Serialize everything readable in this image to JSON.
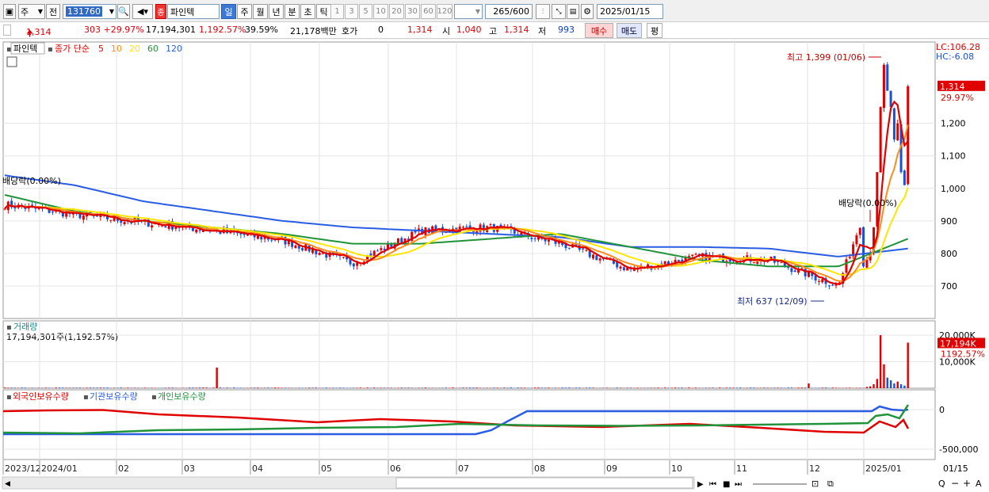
{
  "toolbar": {
    "period_toggle": "주",
    "prev_toggle": "전",
    "code": "131760",
    "name_badge": "종",
    "name": "파인텍",
    "timeframes": [
      "일",
      "주",
      "월",
      "년",
      "분",
      "초",
      "틱"
    ],
    "intervals": [
      "1",
      "3",
      "5",
      "10",
      "20",
      "30",
      "60",
      "120"
    ],
    "count": "265",
    "count_total": "/600",
    "date": "2025/01/15"
  },
  "quote": {
    "price": "1,314",
    "change": "303 +29.97%",
    "volume": "17,194,301",
    "volume_ratio": "1,192.57%",
    "turnover": "39.59%",
    "amount": "21,178백만",
    "hoga_label": "호가",
    "hoga_value": "0",
    "hoga_price": "1,314",
    "open_label": "시",
    "open": "1,040",
    "high_label": "고",
    "high": "1,314",
    "low_label": "저",
    "low": "993",
    "buy": "매수",
    "sell": "매도",
    "eval": "평"
  },
  "price_panel": {
    "name": "파인텍",
    "ma_label": "종가 단순",
    "ma_periods": [
      "5",
      "10",
      "20",
      "60",
      "120"
    ],
    "ma_colors": [
      "#e00000",
      "#ff8c1a",
      "#ffe600",
      "#21933a",
      "#2a5de3"
    ],
    "lc": "LC:106.28",
    "hc": "HC:-6.08",
    "last_price_tag": "1,314",
    "last_change_tag": "29.97%",
    "y_ticks": [
      "1,200",
      "1,100",
      "1,000",
      "900",
      "800",
      "700"
    ],
    "annotations": {
      "high": "최고 1,399 (01/06)",
      "low": "최저 637 (12/09)",
      "dividend_left": "배당락(0.00%)",
      "dividend_right": "배당락(0.00%)"
    }
  },
  "volume_panel": {
    "title": "거래량",
    "value_line": "17,194,301주(1,192.57%)",
    "y_ticks": [
      "20,000K",
      "10,000K"
    ],
    "tag": "17,194K",
    "tag2": "1192.57%"
  },
  "holdings_panel": {
    "series_names": [
      "외국인보유수량",
      "기관보유수량",
      "개인보유수량"
    ],
    "colors": [
      "#e00000",
      "#2a5de3",
      "#21933a"
    ],
    "y_ticks": [
      "0",
      "-500,000"
    ]
  },
  "x_axis": {
    "labels": [
      "2023/12",
      "2024/01",
      "02",
      "03",
      "04",
      "05",
      "06",
      "07",
      "08",
      "09",
      "10",
      "11",
      "12",
      "2025/01"
    ],
    "right_label": "01/15"
  },
  "chart_data": {
    "type": "line",
    "title": "파인텍",
    "x": [
      "2023/12",
      "2024/01",
      "02",
      "03",
      "04",
      "05",
      "06",
      "07",
      "08",
      "09",
      "10",
      "11",
      "12",
      "2025/01"
    ],
    "series": [
      {
        "name": "종가",
        "values": [
          950,
          920,
          895,
          870,
          840,
          770,
          870,
          880,
          830,
          750,
          790,
          780,
          700,
          1314
        ]
      },
      {
        "name": "120",
        "values": [
          1040,
          1010,
          960,
          930,
          900,
          880,
          870,
          860,
          850,
          820,
          820,
          815,
          790,
          815
        ]
      },
      {
        "name": "60",
        "values": [
          980,
          930,
          900,
          880,
          860,
          830,
          830,
          845,
          860,
          820,
          780,
          760,
          760,
          845
        ]
      }
    ],
    "high": 1399,
    "low": 637,
    "ylim": [
      600,
      1450
    ],
    "volume_peak_k": 23000
  }
}
